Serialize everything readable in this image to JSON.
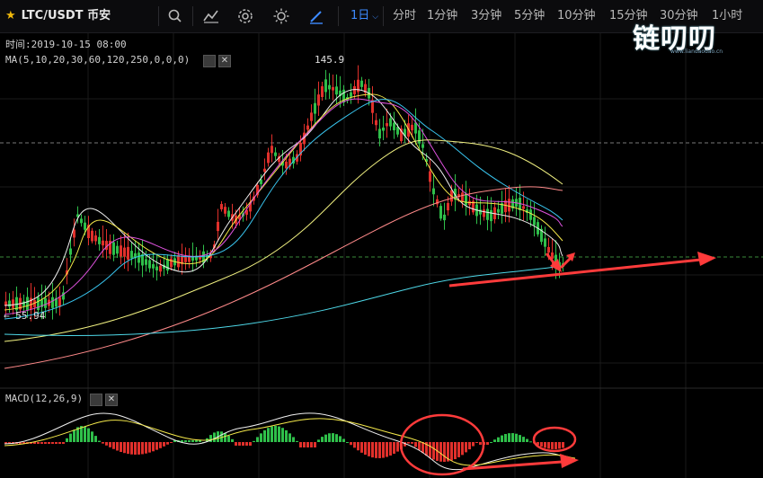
{
  "toolbar": {
    "pair": "LTC/USDT",
    "exchange": "币安",
    "timeframes": [
      {
        "label": "1日",
        "active": true
      },
      {
        "label": "分时",
        "active": false
      },
      {
        "label": "1分钟",
        "active": false
      },
      {
        "label": "3分钟",
        "active": false
      },
      {
        "label": "5分钟",
        "active": false
      },
      {
        "label": "10分钟",
        "active": false
      },
      {
        "label": "15分钟",
        "active": false
      },
      {
        "label": "30分钟",
        "active": false
      },
      {
        "label": "1小时",
        "active": false
      }
    ],
    "icons": [
      "search-icon",
      "indicator-icon",
      "settings-icon",
      "theme-icon",
      "draw-icon"
    ]
  },
  "watermark": {
    "text": "链叨叨",
    "subtext": "www.liandaodao.cn"
  },
  "info": {
    "time": "时间:2019-10-15 08:00",
    "ma": "MA(5,10,20,30,60,120,250,0,0,0)",
    "macd": "MACD(12,26,9)"
  },
  "chart_data": {
    "type": "candlestick",
    "pair": "LTC/USDT",
    "high_label": "145.9",
    "low_label": "← 55.94",
    "indicators": [
      "MA(5,10,20,30,60,120,250)",
      "MACD(12,26,9)"
    ],
    "colors": {
      "up": "#2fbf4a",
      "down": "#e0302b",
      "arrow": "#ff3b3b",
      "circle": "#ff3b3b"
    }
  }
}
